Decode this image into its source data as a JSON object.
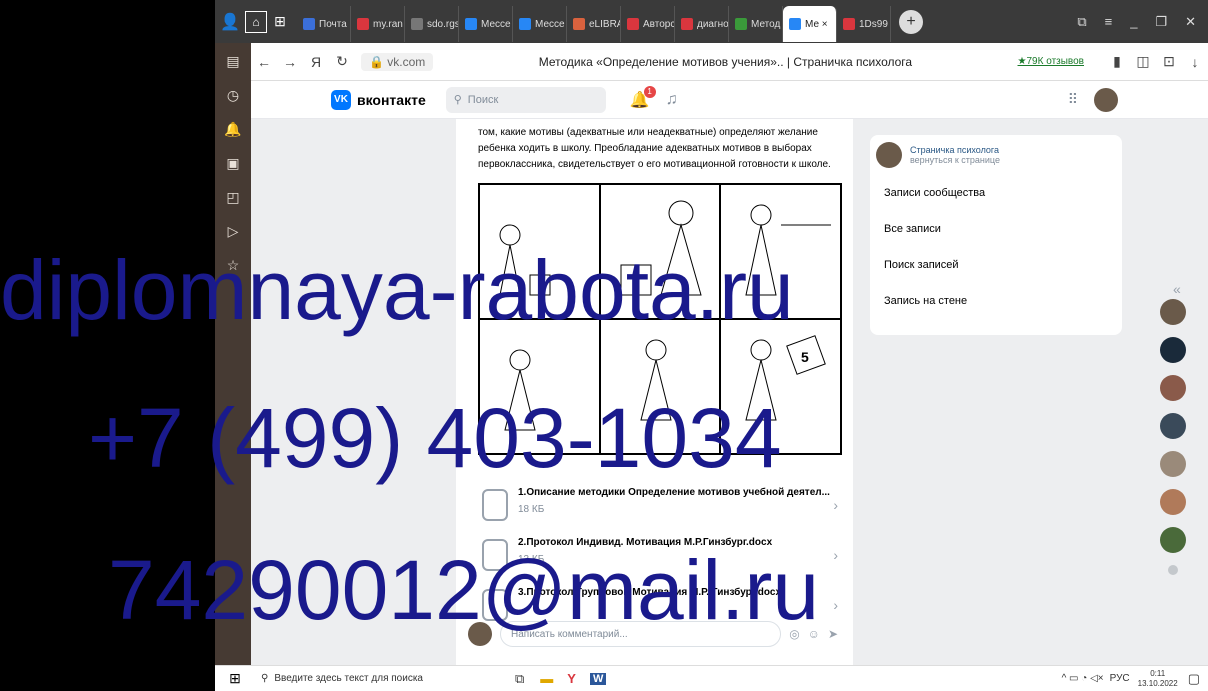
{
  "browser": {
    "tabs": [
      {
        "label": "Почта",
        "color": "#3b6fd9"
      },
      {
        "label": "my.ran",
        "color": "#d9363e"
      },
      {
        "label": "sdo.rgs",
        "color": "#777777"
      },
      {
        "label": "Мессе",
        "color": "#2787f5"
      },
      {
        "label": "Мессе",
        "color": "#2787f5"
      },
      {
        "label": "eLIBRA",
        "color": "#d9623e"
      },
      {
        "label": "Авторс",
        "color": "#d9363e"
      },
      {
        "label": "диагно",
        "color": "#d9363e"
      },
      {
        "label": "Метод",
        "color": "#3a9a3a"
      },
      {
        "label": "Ме ×",
        "color": "#2787f5"
      },
      {
        "label": "1Ds99",
        "color": "#d9363e"
      }
    ],
    "address": "vk.com",
    "page_title": "Методика «Определение мотивов учения».. | Страничка психолога",
    "reviews": "★79К отзывов"
  },
  "vk": {
    "logo": "вконтакте",
    "search_placeholder": "Поиск",
    "notif_count": "1"
  },
  "post": {
    "text_lines": [
      "том, какие мотивы (адекватные или неадекватные) определяют желание",
      "ребенка ходить в школу. Преобладание адекватных мотивов в выборах",
      "первоклассника, свидетельствует о его мотивационной готовности к школе."
    ],
    "docs": [
      {
        "title": "1.Описание методики Определение мотивов учебной деятел...",
        "size": "18 КБ"
      },
      {
        "title": "2.Протокол Индивид. Мотивация М.Р.Гинзбург.docx",
        "size": "13 КБ"
      },
      {
        "title": "3.Протокол Групповой Мотивация М.Р. Гинзбург.docx",
        "size": ""
      }
    ],
    "comment_placeholder": "Написать комментарий..."
  },
  "right_panel": {
    "group_name": "Страничка психолога",
    "back_link": "вернуться к странице",
    "items": [
      "Записи сообщества",
      "Все записи",
      "Поиск записей",
      "Запись на стене"
    ]
  },
  "taskbar": {
    "search_placeholder": "Введите здесь текст для поиска",
    "lang": "РУС",
    "time": "0:11",
    "date": "13.10.2022"
  },
  "watermark": {
    "line1": "diplomnaya-rabota.ru",
    "line2": "+7 (499) 403-1034",
    "line3": "74290012@mail.ru"
  }
}
